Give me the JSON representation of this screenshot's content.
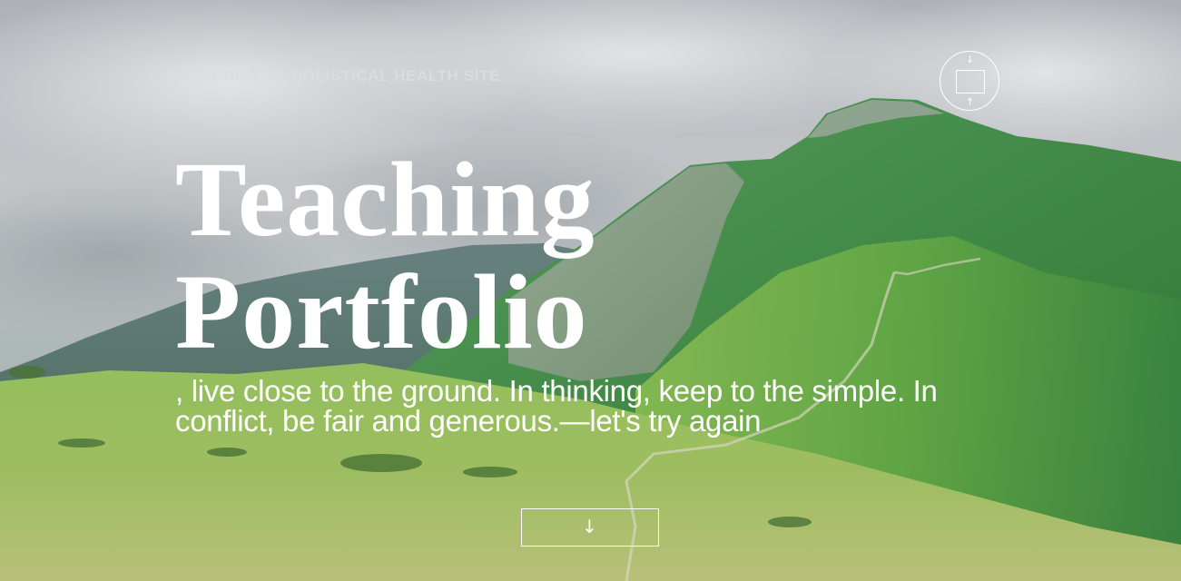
{
  "header": {
    "welcome_text": "WELCOME TO HOLISTICAL HEALTH SITE",
    "menu_button": {
      "icon": "expand-box-icon",
      "arrow_top": "↓",
      "arrow_bottom": "↑"
    }
  },
  "hero": {
    "title_line1": "Teaching",
    "title_line2": "Portfolio",
    "tagline": ", live close to the ground. In thinking, keep to the simple. In conflict, be fair and generous.—let's try again",
    "background": "mountain-landscape-photo",
    "scroll_button": {
      "icon": "arrow-down-icon",
      "glyph": "↓"
    }
  },
  "colors": {
    "text": "#ffffff",
    "welcome_text": "#d7dede",
    "sky": "#b9bfc2",
    "grass": "#7fb24c",
    "mountain": "#2f7a3a"
  }
}
